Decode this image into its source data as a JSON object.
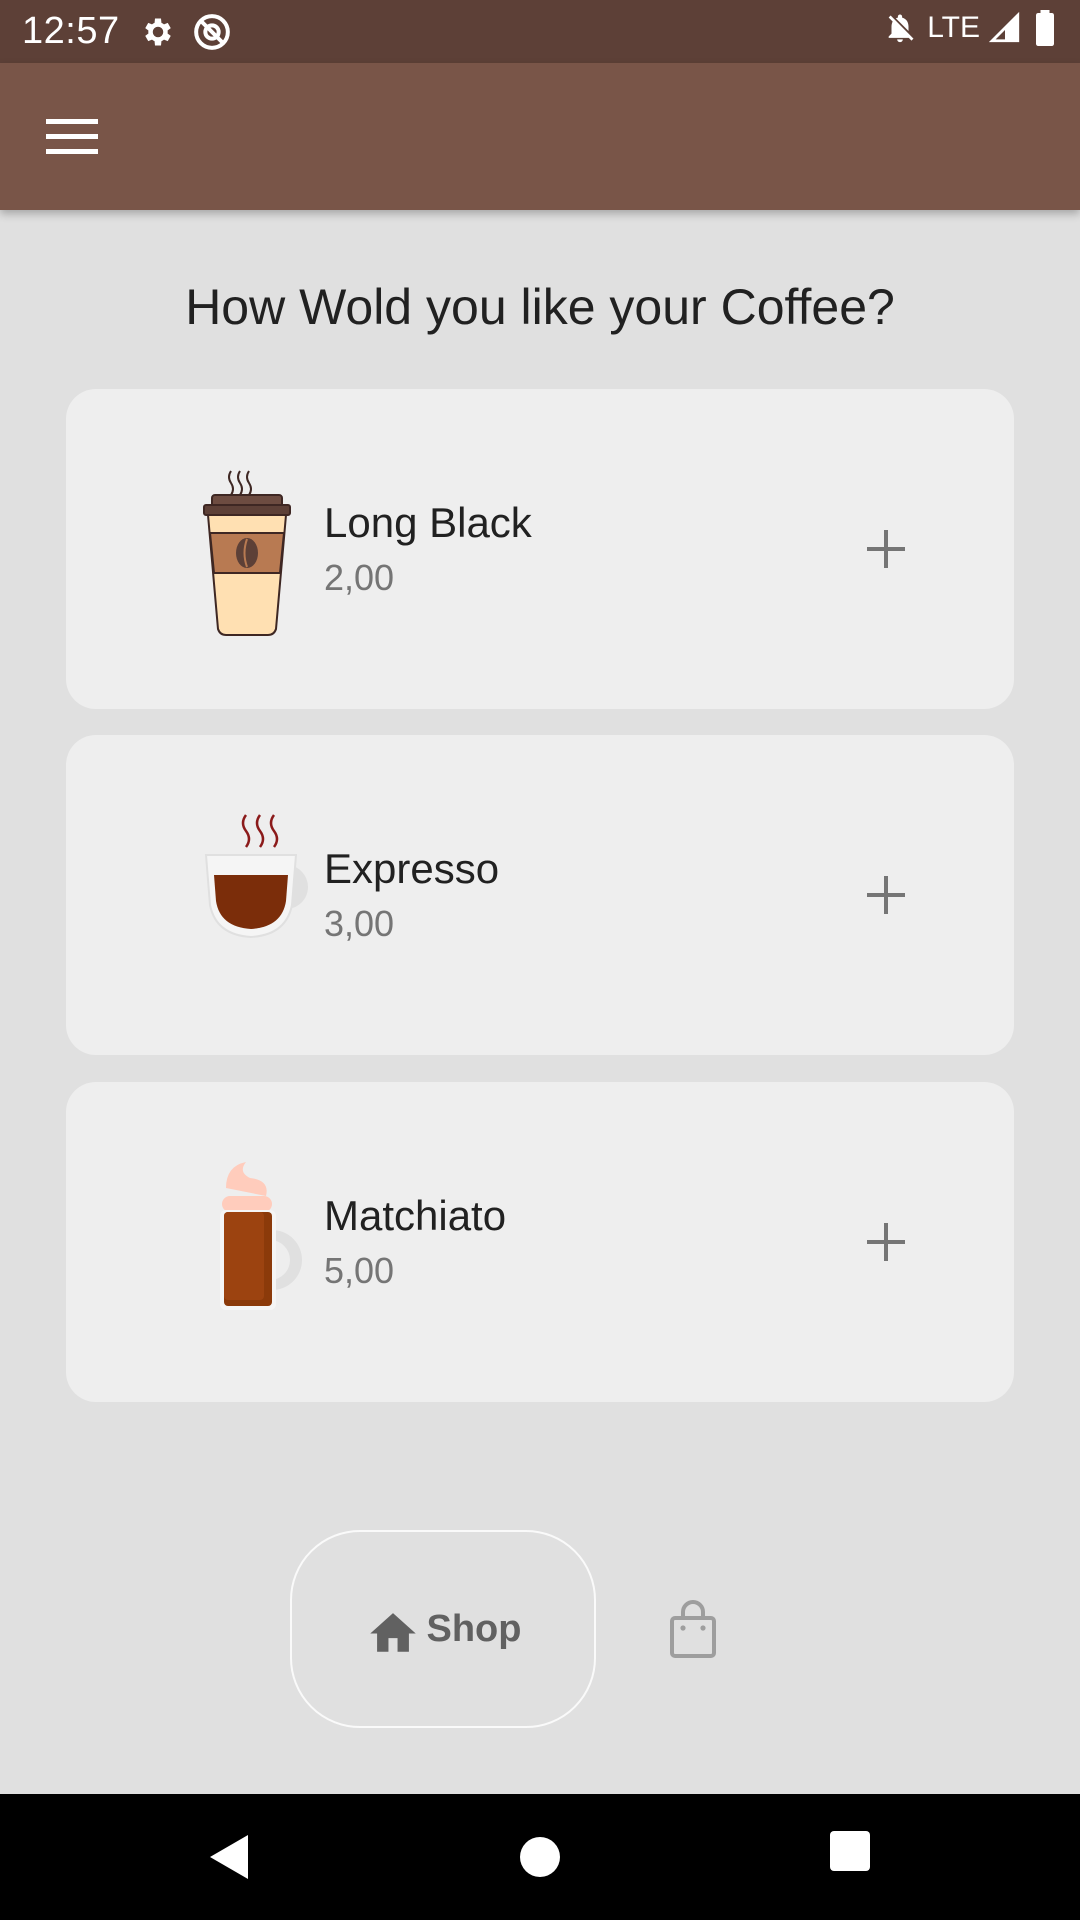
{
  "status_bar": {
    "time": "12:57",
    "network": "LTE",
    "icons": [
      "gear-icon",
      "at-sign-icon",
      "bell-off-icon",
      "signal-icon",
      "battery-icon"
    ]
  },
  "app_bar": {
    "menu_icon": "menu-icon",
    "background_color": "#795548"
  },
  "page": {
    "title": "How Wold you like your Coffee?"
  },
  "products": [
    {
      "name": "Long Black",
      "price": "2,00",
      "icon": "takeaway-coffee-cup-icon"
    },
    {
      "name": "Expresso",
      "price": "3,00",
      "icon": "espresso-cup-icon"
    },
    {
      "name": "Matchiato",
      "price": "5,00",
      "icon": "macchiato-mug-icon"
    }
  ],
  "bottom_nav": {
    "shop_label": "Shop",
    "shop_icon": "home-icon",
    "cart_icon": "shopping-bag-icon"
  },
  "colors": {
    "status_bar": "#5d4037",
    "accent": "#795548",
    "background": "#e0e0e0",
    "card": "#eeeeee"
  }
}
